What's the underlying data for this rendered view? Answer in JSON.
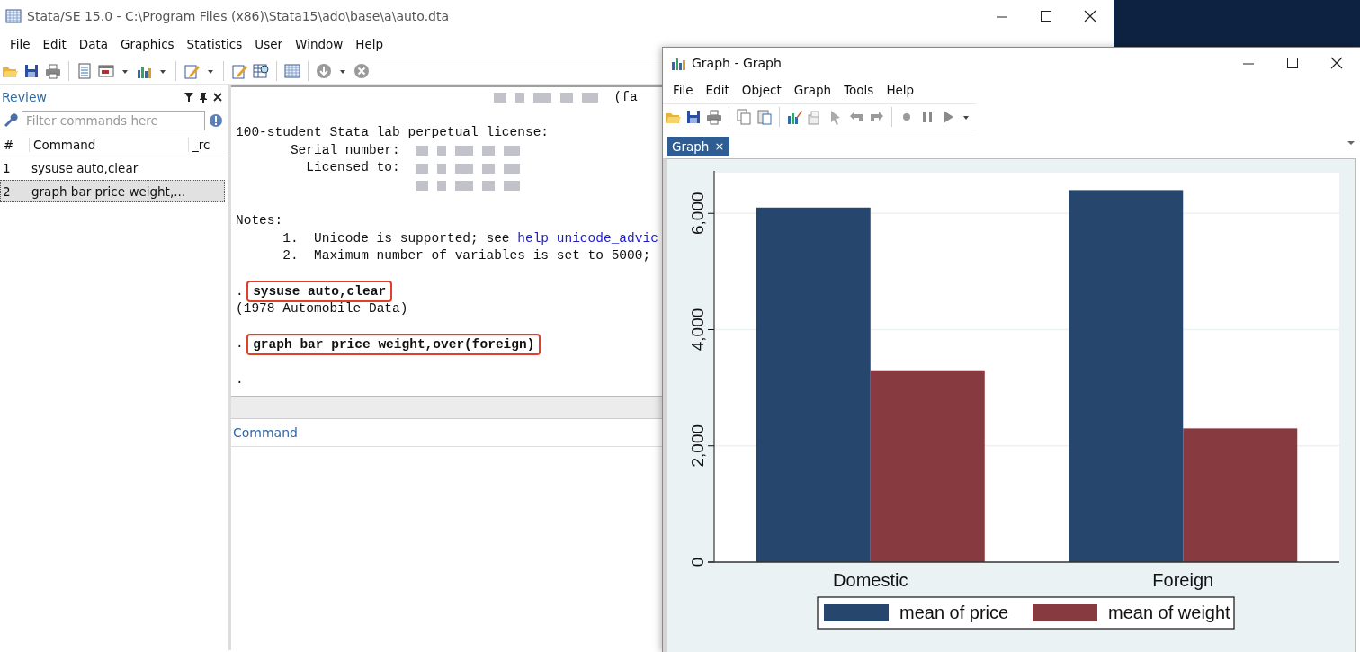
{
  "main_window": {
    "title": "Stata/SE 15.0 - C:\\Program Files (x86)\\Stata15\\ado\\base\\a\\auto.dta",
    "menu": [
      "File",
      "Edit",
      "Data",
      "Graphics",
      "Statistics",
      "User",
      "Window",
      "Help"
    ]
  },
  "review": {
    "title": "Review",
    "filter": {
      "placeholder": "Filter commands here"
    },
    "columns": [
      "#",
      "Command",
      "_rc"
    ],
    "rows": [
      {
        "number": "1",
        "command": "sysuse auto,clear",
        "selected": false
      },
      {
        "number": "2",
        "command": "graph bar price weight,...",
        "selected": true
      }
    ]
  },
  "results": {
    "lines": [
      {
        "kind": "text",
        "text": "(fa",
        "blur_before": true
      },
      {
        "kind": "empty"
      },
      {
        "kind": "text",
        "text": "100-student Stata lab perpetual license:"
      },
      {
        "kind": "text",
        "text": "       Serial number:",
        "blur_after": true
      },
      {
        "kind": "text",
        "text": "         Licensed to:",
        "blur_after": true
      },
      {
        "kind": "blur"
      },
      {
        "kind": "empty"
      },
      {
        "kind": "text",
        "text": "Notes:"
      },
      {
        "kind": "note",
        "number": "1.",
        "text": "Unicode is supported; see",
        "link": "help unicode_advic"
      },
      {
        "kind": "note",
        "number": "2.",
        "text": "Maximum number of variables is set to 5000;"
      },
      {
        "kind": "empty"
      },
      {
        "kind": "command",
        "prompt": ".",
        "text": "sysuse auto,clear",
        "highlighted": true
      },
      {
        "kind": "text",
        "text": "(1978 Automobile Data)"
      },
      {
        "kind": "empty"
      },
      {
        "kind": "command",
        "prompt": ".",
        "text": "graph bar price weight,over(foreign)",
        "highlighted": true
      },
      {
        "kind": "empty"
      },
      {
        "kind": "text",
        "text": "."
      }
    ]
  },
  "command_pane": {
    "title": "Command"
  },
  "graph_window": {
    "title": "Graph - Graph",
    "menu": [
      "File",
      "Edit",
      "Object",
      "Graph",
      "Tools",
      "Help"
    ],
    "tabs": [
      {
        "label": "Graph",
        "selected": true,
        "close": "×"
      }
    ],
    "chart_data": {
      "type": "bar",
      "categories": [
        "Domestic",
        "Foreign"
      ],
      "series": [
        {
          "name": "mean of price",
          "color": "#26466d",
          "values": [
            6100,
            6400
          ]
        },
        {
          "name": "mean of weight",
          "color": "#873a3f",
          "values": [
            3300,
            2300
          ]
        }
      ],
      "grid": true,
      "legend": "bottom",
      "ylim": [
        0,
        6700
      ],
      "yticks": [
        {
          "value": 0,
          "label": "0"
        },
        {
          "value": 2000,
          "label": "2,000"
        },
        {
          "value": 4000,
          "label": "4,000"
        },
        {
          "value": 6000,
          "label": "6,000"
        }
      ]
    }
  }
}
